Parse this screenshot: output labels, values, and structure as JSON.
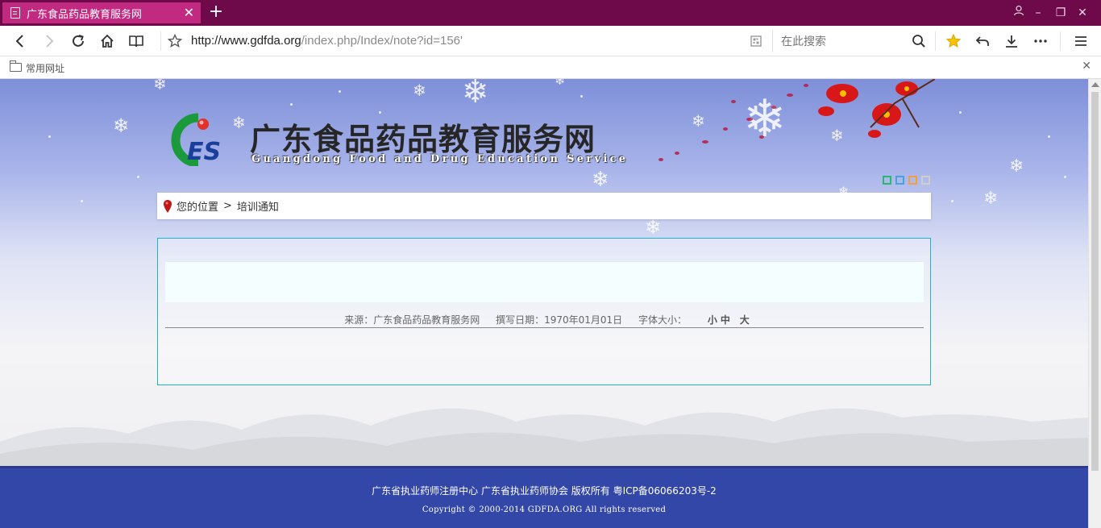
{
  "browser": {
    "tab_title": "广东食品药品教育服务网",
    "tab_close": "✕",
    "new_tab": "+",
    "url_host": "http://www.gdfda.org",
    "url_path": "/index.php/Index/note?id=156'",
    "search_placeholder": "在此搜索",
    "window_controls": {
      "account": "user-icon",
      "minimize": "–",
      "restore": "❐",
      "close": "✕"
    },
    "toolbar_icons": [
      "back-icon",
      "forward-icon",
      "reload-icon",
      "home-icon",
      "reader-icon",
      "star-outline-icon",
      "qr-code-icon",
      "search-icon",
      "favorite-star-icon",
      "undo-icon",
      "download-icon",
      "more-icon",
      "menu-icon"
    ],
    "accent_color": "#6e0a4a",
    "tab_color": "#c22a82"
  },
  "bookmarks": {
    "folder_label": "常用网址",
    "close": "✕"
  },
  "site": {
    "title": "广东食品药品教育服务网",
    "subtitle": "Guangdong Food and Drug Education Service",
    "logo_text": "ES",
    "theme_colors": [
      "#2bb673",
      "#4aa3df",
      "#f0a040",
      "#cfcfcf"
    ]
  },
  "breadcrumb": {
    "label": "您的位置",
    "separator": ">",
    "current": "培训通知"
  },
  "article": {
    "source": "来源：广东食品药品教育服务网",
    "date": "撰写日期：1970年01月01日",
    "font_size_label": "字体大小：",
    "font_small": "小",
    "font_medium": "中",
    "font_large": "大"
  },
  "footer": {
    "line1": "广东省执业药师注册中心 广东省执业药师协会 版权所有 粤ICP备06066203号-2",
    "line2": "Copyright © 2000-2014 GDFDA.ORG All rights reserved",
    "background": "#3347a8"
  }
}
